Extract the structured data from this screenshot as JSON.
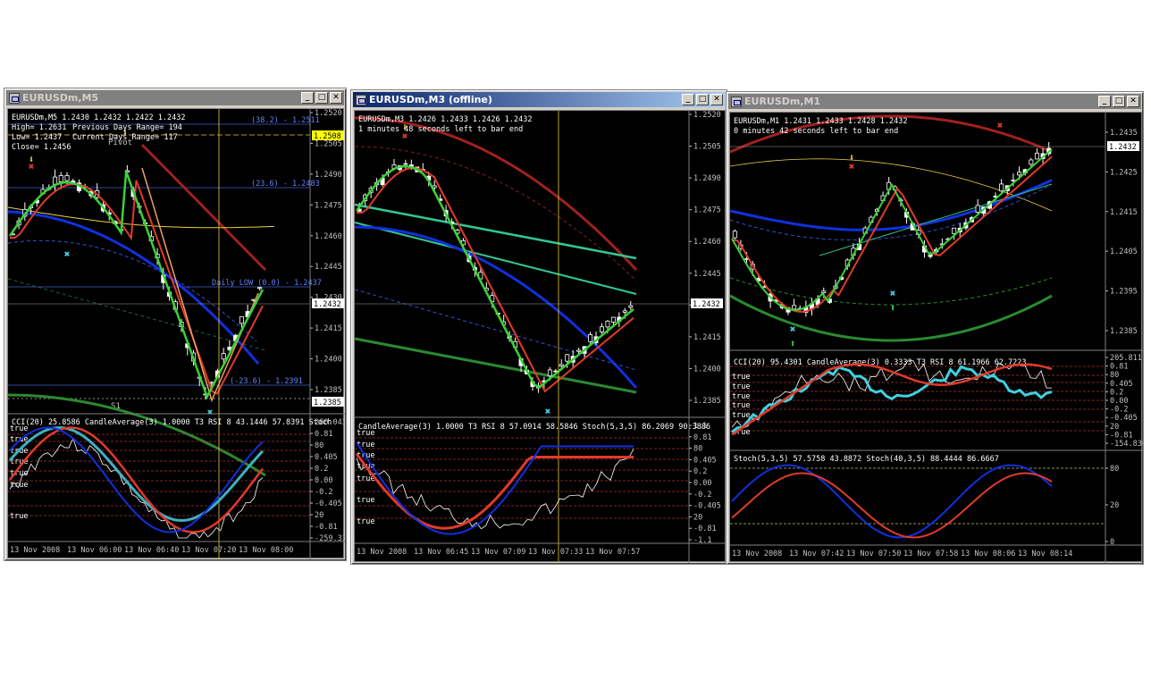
{
  "windows": [
    {
      "id": "w1",
      "title": "EURUSDm,M5",
      "active": false,
      "main": {
        "ohlc": "EURUSDm,M5 1.2430 1.2432 1.2422 1.2432",
        "info": [
          "High= 1.2631",
          "Low= 1.2437",
          "Close= 1.2456"
        ],
        "info2": [
          "Previous Days Range= 194",
          "Current Days Range= 117"
        ],
        "pivot": "Pivot",
        "s1": "S1",
        "fib": [
          "(38.2) - 1.2511",
          "(23.6) - 1.2483",
          "Daily LOW (0.0) - 1.2437",
          "(-23.6) - 1.2391"
        ],
        "yticks": [
          "1.2520",
          "1.2505",
          "1.2490",
          "1.2475",
          "1.2460",
          "1.2445",
          "1.2430",
          "1.2415",
          "1.2400",
          "1.2385"
        ],
        "price": "1.2432",
        "hl": "1.2508",
        "low_label": "1.2385"
      },
      "sub": {
        "header": "CCI(20) 25.8586 CandleAverage(3) 1.0000 T3 RSI 8 43.1446 57.8391 Stoch",
        "yticks": [
          "280.043",
          "0.81",
          "80",
          "0.405",
          "0.2",
          "0.00",
          "-0.2",
          "-0.405",
          "20",
          "-0.81",
          "-259.335"
        ]
      },
      "xlabels": [
        "13 Nov 2008",
        "13 Nov 06:00",
        "13 Nov 06:40",
        "13 Nov 07:20",
        "13 Nov 08:00"
      ]
    },
    {
      "id": "w2",
      "title": "EURUSDm,M3 (offline)",
      "active": true,
      "main": {
        "ohlc": "EURUSDm,M3 1.2426 1.2433 1.2426 1.2432",
        "info": [
          "1 minutes 48 seconds left to bar end"
        ],
        "yticks": [
          "1.2520",
          "1.2505",
          "1.2490",
          "1.2475",
          "1.2460",
          "1.2445",
          "1.2430",
          "1.2415",
          "1.2400",
          "1.2385"
        ],
        "price": "1.2432"
      },
      "sub": {
        "header": "CandleAverage(3) 1.0000 T3 RSI 8 57.0914 58.5846 Stoch(5,3,5) 86.2069 90.3886",
        "yticks": [
          "1.1",
          "0.81",
          "80",
          "0.405",
          "0.2",
          "0.00",
          "-0.2",
          "-0.405",
          "20",
          "-0.81",
          "-1.1"
        ]
      },
      "xlabels": [
        "13 Nov 2008",
        "13 Nov 06:45",
        "13 Nov 07:09",
        "13 Nov 07:33",
        "13 Nov 07:57"
      ]
    },
    {
      "id": "w3",
      "title": "EURUSDm,M1",
      "active": false,
      "main": {
        "ohlc": "EURUSDm,M1 1.2431 1.2433 1.2428 1.2432",
        "info": [
          "0 minutes 42 seconds left to bar end"
        ],
        "yticks": [
          "1.2435",
          "1.2425",
          "1.2415",
          "1.2405",
          "1.2395",
          "1.2385"
        ],
        "price": "1.2432"
      },
      "sub": {
        "header": "CCI(20) 95.4301 CandleAverage(3) 0.3333 T3 RSI 8 61.1966 62.7223",
        "yticks": [
          "205.8111",
          "0.81",
          "80",
          "0.405",
          "0.2",
          "0.00",
          "-0.2",
          "-0.405",
          "20",
          "-0.81",
          "-154.836"
        ]
      },
      "sub2": {
        "header": "Stoch(5,3,5) 57.5758 43.8872 Stoch(40,3,5) 88.4444 86.6667",
        "yticks": [
          "80",
          "20",
          "0"
        ]
      },
      "xlabels": [
        "13 Nov 2008",
        "13 Nov 07:42",
        "13 Nov 07:50",
        "13 Nov 07:58",
        "13 Nov 08:06",
        "13 Nov 08:14"
      ]
    }
  ],
  "indicator_label": "true",
  "buttons": {
    "minimize": "_",
    "maximize": "□",
    "close": "✕"
  },
  "colors": {
    "bg": "#000000",
    "axis": "#c0c0c0",
    "bull": "#ffffff",
    "green_ma": "#39d039",
    "red_ma": "#e23a2a",
    "blue_ma": "#1030e0",
    "dark_red": "#a02020",
    "dark_green": "#2a8a30",
    "teal": "#30c890",
    "yellow": "#e8d040",
    "fib": "#4060d0"
  }
}
